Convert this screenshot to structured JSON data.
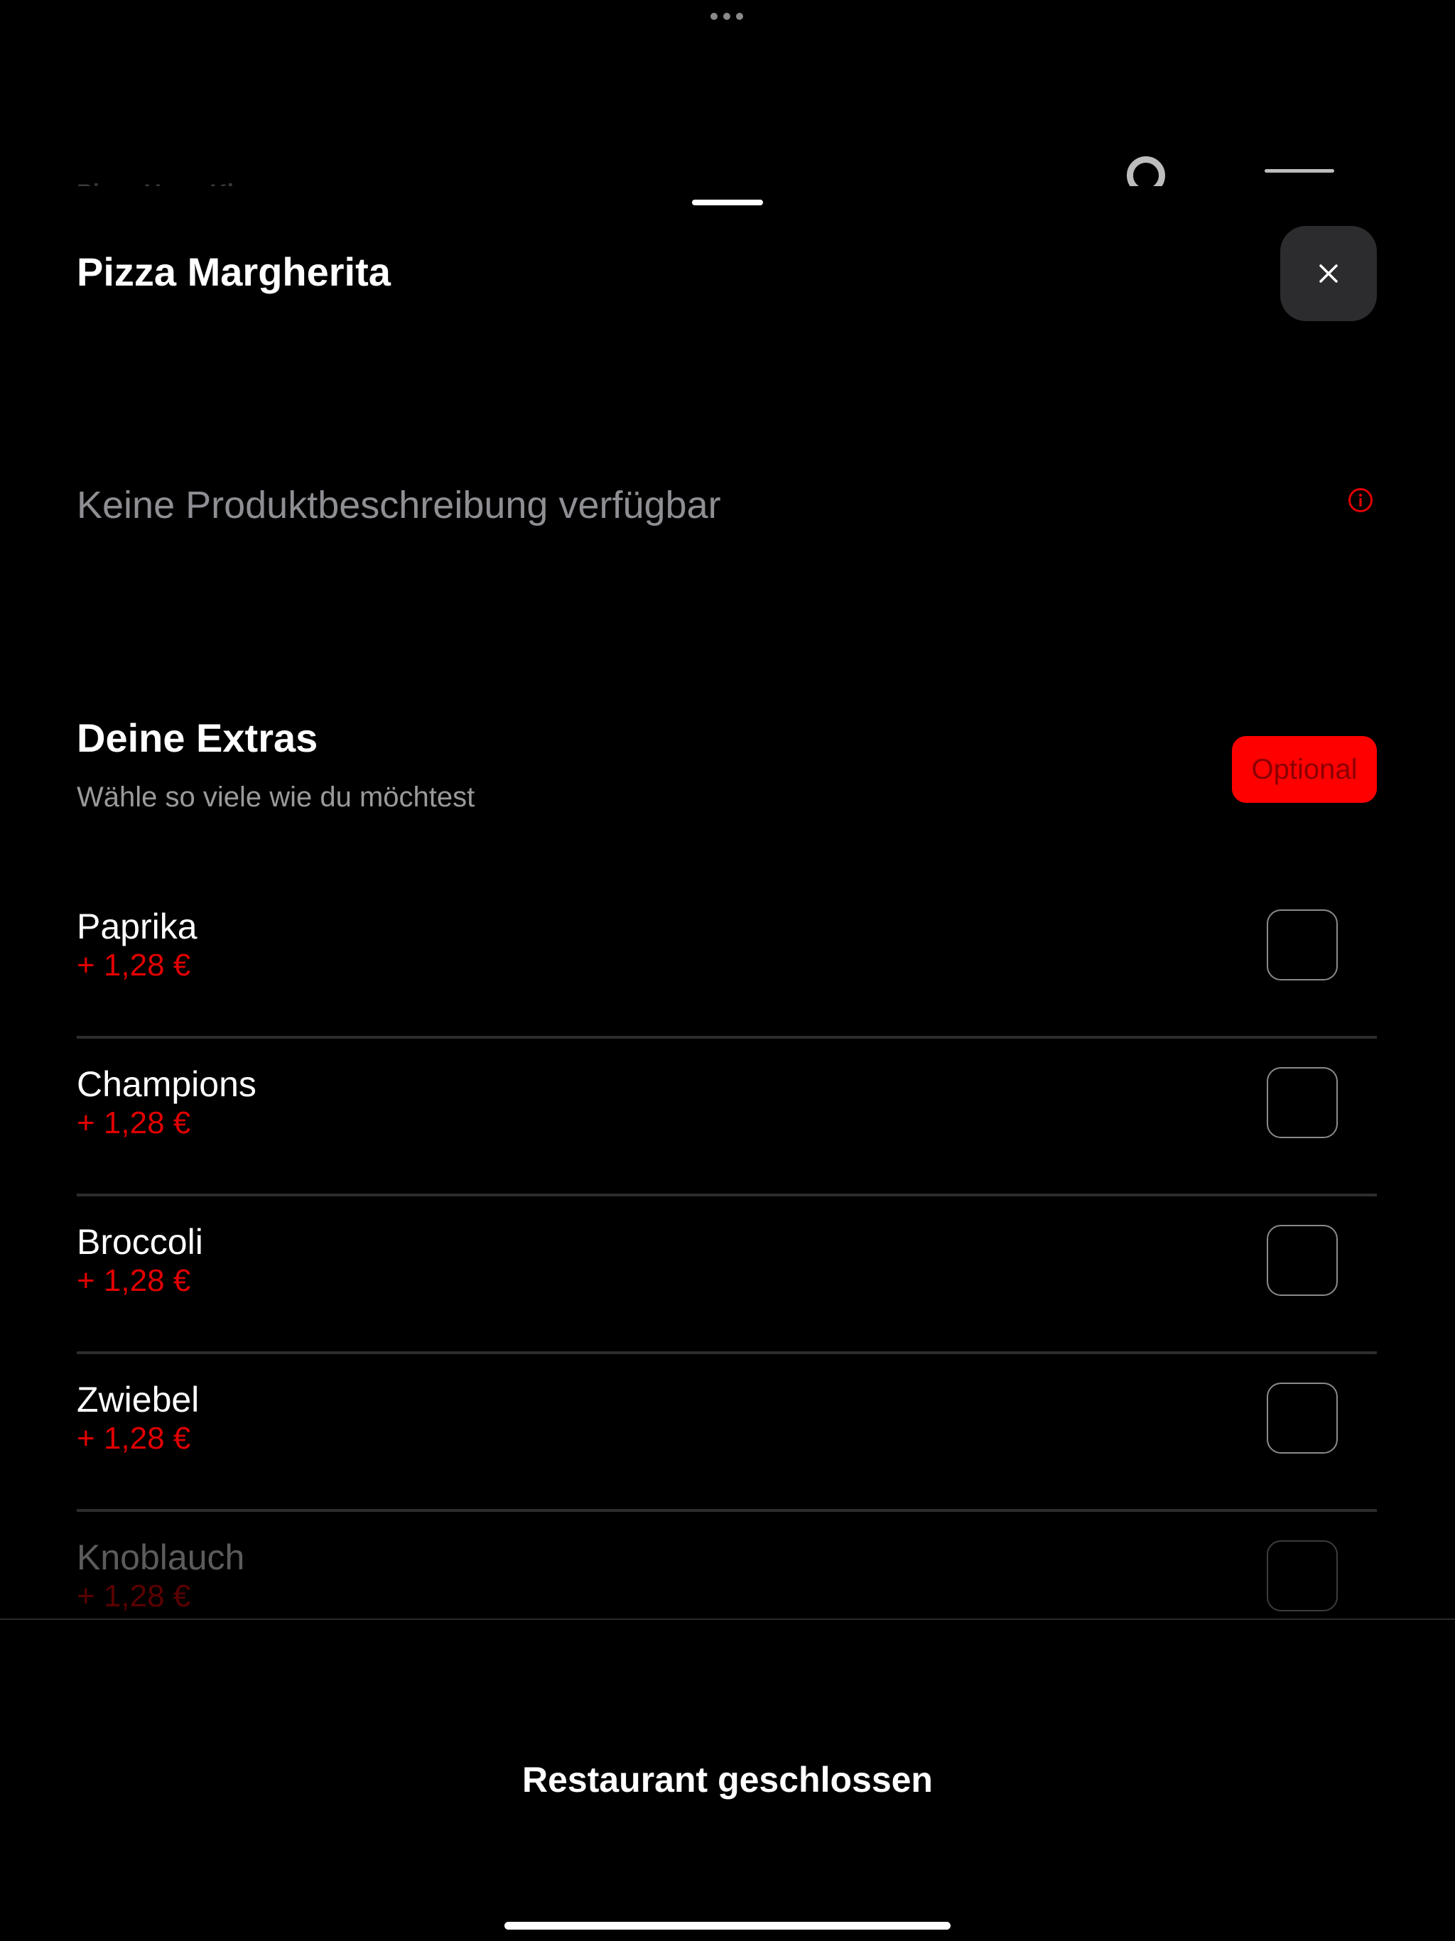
{
  "background": {
    "restaurant_name": "Pizza Haus Kleve"
  },
  "product": {
    "title": "Pizza Margherita",
    "description": "Keine Produktbeschreibung verfügbar"
  },
  "extras_section": {
    "title": "Deine Extras",
    "subtitle": "Wähle so viele wie du möchtest",
    "badge": "Optional",
    "items": [
      {
        "name": "Paprika",
        "price": "+ 1,28 €",
        "checked": false
      },
      {
        "name": "Champions",
        "price": "+ 1,28 €",
        "checked": false
      },
      {
        "name": "Broccoli",
        "price": "+ 1,28 €",
        "checked": false
      },
      {
        "name": "Zwiebel",
        "price": "+ 1,28 €",
        "checked": false
      },
      {
        "name": "Knoblauch",
        "price": "+ 1,28 €",
        "checked": false
      }
    ]
  },
  "footer": {
    "status": "Restaurant geschlossen"
  },
  "colors": {
    "accent": "#ff0000",
    "price": "#e00000",
    "background": "#000000",
    "close_button_bg": "#2c2c2e"
  },
  "icons": {
    "close": "close-icon",
    "info": "info-icon",
    "menu": "hamburger-menu-icon",
    "ring": "ring-icon"
  }
}
